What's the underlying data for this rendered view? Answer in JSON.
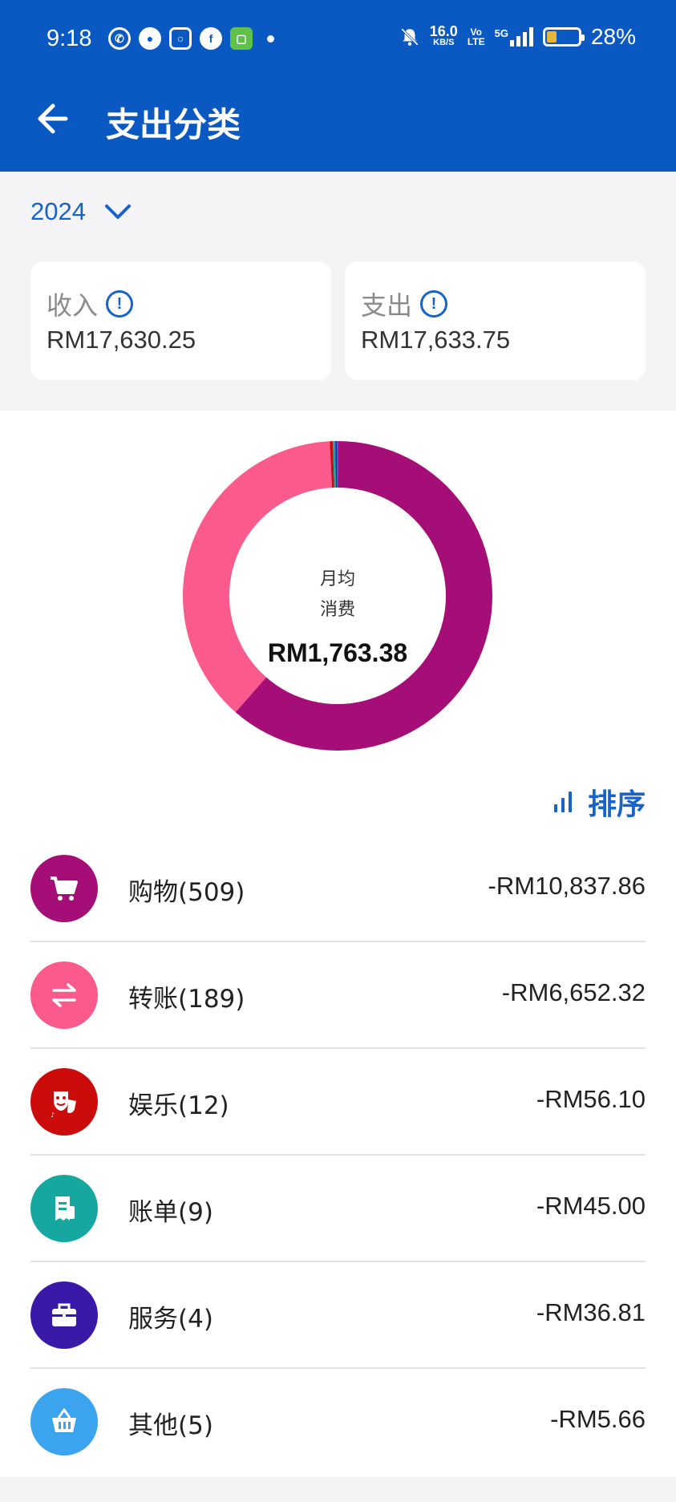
{
  "status_bar": {
    "time": "9:18",
    "net_speed_value": "16.0",
    "net_speed_unit": "KB/S",
    "volte_top": "Vo",
    "volte_bottom": "LTE",
    "network_type": "5G",
    "battery_percent": "28%",
    "app_icons": [
      "whatsapp-icon",
      "wechat-icon",
      "instagram-icon",
      "facebook-icon",
      "android-app-icon"
    ]
  },
  "header": {
    "title": "支出分类"
  },
  "year_selector": {
    "year": "2024"
  },
  "summary": {
    "income_label": "收入",
    "income_value": "RM17,630.25",
    "expense_label": "支出",
    "expense_value": "RM17,633.75"
  },
  "donut": {
    "center_line1": "月均",
    "center_line2": "消费",
    "center_value": "RM1,763.38"
  },
  "sort": {
    "label": "排序"
  },
  "categories": [
    {
      "name": "购物(509)",
      "amount": "-RM10,837.86",
      "value": 10837.86,
      "color": "#a50e76",
      "icon": "shopping-cart-icon"
    },
    {
      "name": "转账(189)",
      "amount": "-RM6,652.32",
      "value": 6652.32,
      "color": "#fb5b8c",
      "icon": "transfer-arrows-icon"
    },
    {
      "name": "娱乐(12)",
      "amount": "-RM56.10",
      "value": 56.1,
      "color": "#cc0b0b",
      "icon": "theater-masks-icon"
    },
    {
      "name": "账单(9)",
      "amount": "-RM45.00",
      "value": 45.0,
      "color": "#16a8a0",
      "icon": "bill-receipt-icon"
    },
    {
      "name": "服务(4)",
      "amount": "-RM36.81",
      "value": 36.81,
      "color": "#3a18a8",
      "icon": "briefcase-icon"
    },
    {
      "name": "其他(5)",
      "amount": "-RM5.66",
      "value": 5.66,
      "color": "#3aa4ee",
      "icon": "basket-icon"
    }
  ]
}
